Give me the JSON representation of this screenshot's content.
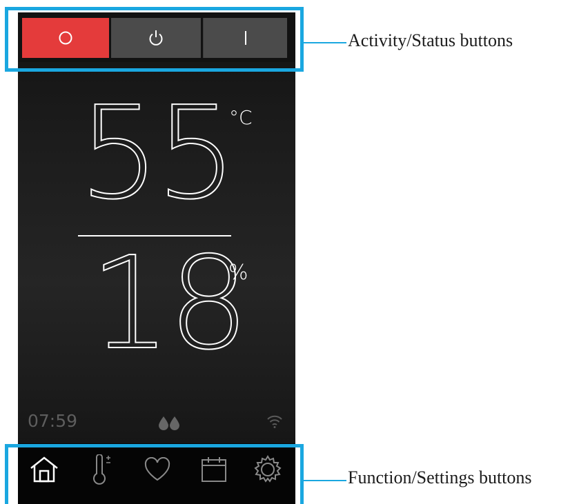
{
  "status_buttons": {
    "off": {
      "icon": "circle-icon",
      "color": "#e43b3b"
    },
    "standby": {
      "icon": "power-icon",
      "color": "#4b4b4b"
    },
    "on": {
      "icon": "on-bar-icon",
      "color": "#4b4b4b"
    }
  },
  "display": {
    "temperature": "55",
    "temperature_unit": "°C",
    "humidity": "18",
    "humidity_unit": "%",
    "time": "07:59"
  },
  "indicators": {
    "water": "drops-icon",
    "network": "wifi-icon"
  },
  "nav": [
    {
      "icon": "home-icon"
    },
    {
      "icon": "thermometer-icon"
    },
    {
      "icon": "heart-icon"
    },
    {
      "icon": "calendar-icon"
    },
    {
      "icon": "gear-icon"
    }
  ],
  "annotations": {
    "top_label": "Activity/Status buttons",
    "bottom_label": "Function/Settings buttons",
    "color": "#1aa7e0"
  }
}
